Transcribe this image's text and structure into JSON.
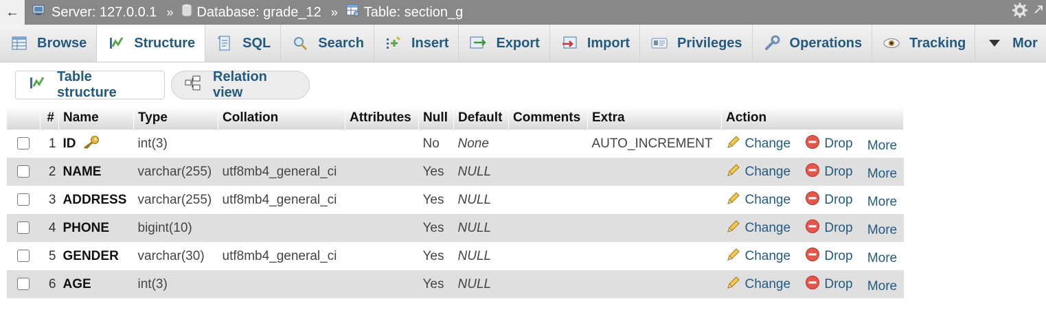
{
  "breadcrumb": {
    "back_label": "←",
    "server": "Server: 127.0.0.1",
    "database": "Database: grade_12",
    "table": "Table: section_g",
    "sep": "»"
  },
  "tabs": [
    {
      "label": "Browse",
      "icon": "browse-icon"
    },
    {
      "label": "Structure",
      "icon": "structure-icon",
      "active": true
    },
    {
      "label": "SQL",
      "icon": "sql-icon"
    },
    {
      "label": "Search",
      "icon": "search-icon"
    },
    {
      "label": "Insert",
      "icon": "insert-icon"
    },
    {
      "label": "Export",
      "icon": "export-icon"
    },
    {
      "label": "Import",
      "icon": "import-icon"
    },
    {
      "label": "Privileges",
      "icon": "privileges-icon"
    },
    {
      "label": "Operations",
      "icon": "operations-icon"
    },
    {
      "label": "Tracking",
      "icon": "tracking-icon"
    },
    {
      "label": "Mor",
      "icon": "more-dropdown-icon"
    }
  ],
  "subnav": {
    "table_structure": "Table structure",
    "relation_view": "Relation view"
  },
  "columns": [
    "#",
    "Name",
    "Type",
    "Collation",
    "Attributes",
    "Null",
    "Default",
    "Comments",
    "Extra",
    "Action"
  ],
  "actions": {
    "change": "Change",
    "drop": "Drop",
    "more": "More"
  },
  "rows": [
    {
      "num": "1",
      "name": "ID",
      "primary_key": true,
      "type": "int(3)",
      "collation": "",
      "attributes": "",
      "null": "No",
      "default": "None",
      "comments": "",
      "extra": "AUTO_INCREMENT"
    },
    {
      "num": "2",
      "name": "NAME",
      "type": "varchar(255)",
      "collation": "utf8mb4_general_ci",
      "attributes": "",
      "null": "Yes",
      "default": "NULL",
      "comments": "",
      "extra": ""
    },
    {
      "num": "3",
      "name": "ADDRESS",
      "type": "varchar(255)",
      "collation": "utf8mb4_general_ci",
      "attributes": "",
      "null": "Yes",
      "default": "NULL",
      "comments": "",
      "extra": ""
    },
    {
      "num": "4",
      "name": "PHONE",
      "type": "bigint(10)",
      "collation": "",
      "attributes": "",
      "null": "Yes",
      "default": "NULL",
      "comments": "",
      "extra": ""
    },
    {
      "num": "5",
      "name": "GENDER",
      "type": "varchar(30)",
      "collation": "utf8mb4_general_ci",
      "attributes": "",
      "null": "Yes",
      "default": "NULL",
      "comments": "",
      "extra": ""
    },
    {
      "num": "6",
      "name": "AGE",
      "type": "int(3)",
      "collation": "",
      "attributes": "",
      "null": "Yes",
      "default": "NULL",
      "comments": "",
      "extra": ""
    }
  ],
  "colors": {
    "link": "#235a81",
    "header_bar": "#888888",
    "row_alt": "#dfdfdf"
  }
}
